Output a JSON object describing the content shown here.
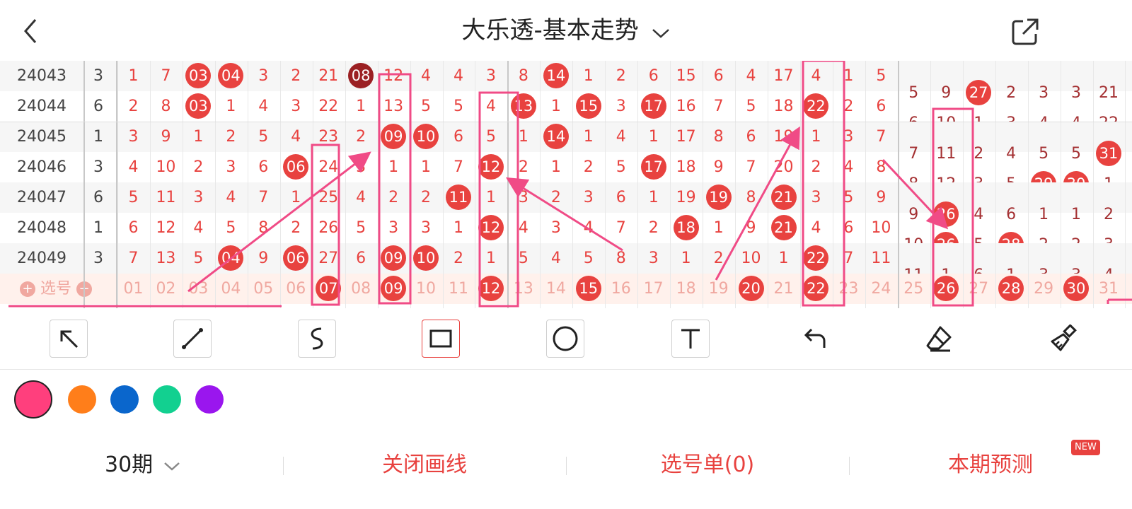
{
  "header": {
    "title": "大乐透-基本走势",
    "back_icon": "chevron-left-icon",
    "share_icon": "share-icon"
  },
  "grid": {
    "rows": [
      {
        "period": "24043",
        "sum": "3",
        "front": [
          "1",
          "7",
          "03",
          "04",
          "3",
          "2",
          "21",
          "08",
          "12",
          "4",
          "4",
          "3",
          "8",
          "14",
          "1",
          "2",
          "6",
          "15",
          "6",
          "4",
          "17",
          "4",
          "1",
          "5"
        ],
        "back": [
          "5",
          "9",
          "27",
          "2",
          "3",
          "3",
          "21"
        ]
      },
      {
        "period": "24044",
        "sum": "6",
        "front": [
          "2",
          "8",
          "03",
          "1",
          "4",
          "3",
          "22",
          "1",
          "13",
          "5",
          "5",
          "4",
          "13",
          "1",
          "15",
          "3",
          "17",
          "16",
          "7",
          "5",
          "18",
          "22",
          "2",
          "6"
        ],
        "back": [
          "6",
          "10",
          "1",
          "3",
          "4",
          "4",
          "22"
        ]
      },
      {
        "period": "24045",
        "sum": "1",
        "front": [
          "3",
          "9",
          "1",
          "2",
          "5",
          "4",
          "23",
          "2",
          "09",
          "10",
          "6",
          "5",
          "1",
          "14",
          "1",
          "4",
          "1",
          "17",
          "8",
          "6",
          "19",
          "1",
          "3",
          "7"
        ],
        "back": [
          "7",
          "11",
          "2",
          "4",
          "5",
          "5",
          "31"
        ]
      },
      {
        "period": "24046",
        "sum": "3",
        "front": [
          "4",
          "10",
          "2",
          "3",
          "6",
          "06",
          "24",
          "3",
          "1",
          "1",
          "7",
          "12",
          "2",
          "1",
          "2",
          "5",
          "17",
          "18",
          "9",
          "7",
          "20",
          "2",
          "4",
          "8"
        ],
        "back": [
          "8",
          "12",
          "3",
          "5",
          "29",
          "30",
          "1"
        ]
      },
      {
        "period": "24047",
        "sum": "6",
        "front": [
          "5",
          "11",
          "3",
          "4",
          "7",
          "1",
          "25",
          "4",
          "2",
          "2",
          "11",
          "1",
          "3",
          "2",
          "3",
          "6",
          "1",
          "19",
          "19",
          "8",
          "21",
          "3",
          "5",
          "9"
        ],
        "back": [
          "9",
          "26",
          "4",
          "6",
          "1",
          "1",
          "2"
        ]
      },
      {
        "period": "24048",
        "sum": "1",
        "front": [
          "6",
          "12",
          "4",
          "5",
          "8",
          "2",
          "26",
          "5",
          "3",
          "3",
          "1",
          "12",
          "4",
          "3",
          "4",
          "7",
          "2",
          "18",
          "1",
          "9",
          "21",
          "4",
          "6",
          "10"
        ],
        "back": [
          "10",
          "26",
          "5",
          "28",
          "2",
          "2",
          "3"
        ]
      },
      {
        "period": "24049",
        "sum": "3",
        "front": [
          "7",
          "13",
          "5",
          "04",
          "9",
          "06",
          "27",
          "6",
          "09",
          "10",
          "2",
          "1",
          "5",
          "4",
          "5",
          "8",
          "3",
          "1",
          "2",
          "10",
          "1",
          "22",
          "7",
          "11"
        ],
        "back": [
          "11",
          "1",
          "6",
          "1",
          "3",
          "3",
          "4"
        ]
      }
    ],
    "balls": {
      "24043": [
        2,
        3,
        7,
        13,
        26
      ],
      "24044": [
        2,
        12,
        14,
        16,
        21
      ],
      "24045": [
        8,
        9,
        13,
        30
      ],
      "24046": [
        5,
        11,
        16,
        28,
        29
      ],
      "24047": [
        10,
        18,
        20,
        25
      ],
      "24048": [
        11,
        17,
        20,
        25,
        27
      ],
      "24049": [
        3,
        5,
        8,
        9,
        21
      ]
    },
    "dark_balls": {
      "24043": [
        7
      ]
    },
    "select_row": {
      "label": "选号",
      "plus_icon": "plus-circle-icon",
      "minus_icon": "minus-circle-icon",
      "numbers": [
        "01",
        "02",
        "03",
        "04",
        "05",
        "06",
        "07",
        "08",
        "09",
        "10",
        "11",
        "12",
        "13",
        "14",
        "15",
        "16",
        "17",
        "18",
        "19",
        "20",
        "21",
        "22",
        "23",
        "24",
        "25",
        "26",
        "27",
        "28",
        "29",
        "30",
        "31"
      ],
      "selected": [
        6,
        8,
        11,
        14,
        19,
        21,
        25,
        27,
        29
      ]
    }
  },
  "toolbar": {
    "tools": [
      {
        "name": "arrow-tool",
        "icon": "arrow-up-left-icon"
      },
      {
        "name": "line-tool",
        "icon": "line-icon"
      },
      {
        "name": "curve-tool",
        "icon": "curve-icon"
      },
      {
        "name": "rectangle-tool",
        "icon": "rectangle-icon",
        "active": true
      },
      {
        "name": "circle-tool",
        "icon": "circle-icon"
      },
      {
        "name": "text-tool",
        "icon": "text-icon"
      },
      {
        "name": "undo-tool",
        "icon": "undo-icon"
      },
      {
        "name": "eraser-tool",
        "icon": "eraser-icon"
      },
      {
        "name": "clear-tool",
        "icon": "broom-icon"
      }
    ]
  },
  "colors": {
    "swatches": [
      "#ff3f7d",
      "#ff7e1a",
      "#0a66cc",
      "#12d090",
      "#9a16ee"
    ],
    "selected": "#ff3f7d"
  },
  "accent": "#e8423f",
  "bottom": {
    "period_label": "30期",
    "close_drawing": "关闭画线",
    "pick_list": "选号单(0)",
    "prediction": "本期预测",
    "new_badge": "NEW"
  }
}
